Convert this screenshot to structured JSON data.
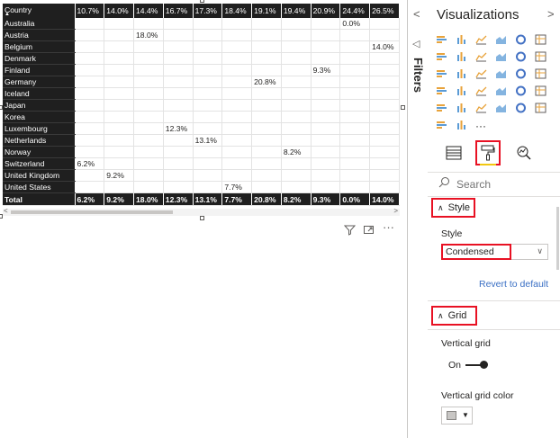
{
  "matrix": {
    "columns": [
      "Country",
      "10.7%",
      "14.0%",
      "14.4%",
      "16.7%",
      "17.3%",
      "18.4%",
      "19.1%",
      "19.4%",
      "20.9%",
      "24.4%",
      "26.5%"
    ],
    "rows": [
      {
        "label": "Australia",
        "cells": [
          "",
          "",
          "",
          "",
          "",
          "",
          "",
          "",
          "",
          "0.0%",
          ""
        ]
      },
      {
        "label": "Austria",
        "cells": [
          "",
          "",
          "18.0%",
          "",
          "",
          "",
          "",
          "",
          "",
          "",
          ""
        ]
      },
      {
        "label": "Belgium",
        "cells": [
          "",
          "",
          "",
          "",
          "",
          "",
          "",
          "",
          "",
          "",
          "14.0%"
        ]
      },
      {
        "label": "Denmark",
        "cells": [
          "",
          "",
          "",
          "",
          "",
          "",
          "",
          "",
          "",
          "",
          ""
        ]
      },
      {
        "label": "Finland",
        "cells": [
          "",
          "",
          "",
          "",
          "",
          "",
          "",
          "",
          "9.3%",
          "",
          ""
        ]
      },
      {
        "label": "Germany",
        "cells": [
          "",
          "",
          "",
          "",
          "",
          "",
          "20.8%",
          "",
          "",
          "",
          ""
        ]
      },
      {
        "label": "Iceland",
        "cells": [
          "",
          "",
          "",
          "",
          "",
          "",
          "",
          "",
          "",
          "",
          ""
        ]
      },
      {
        "label": "Japan",
        "cells": [
          "",
          "",
          "",
          "",
          "",
          "",
          "",
          "",
          "",
          "",
          ""
        ]
      },
      {
        "label": "Korea",
        "cells": [
          "",
          "",
          "",
          "",
          "",
          "",
          "",
          "",
          "",
          "",
          ""
        ]
      },
      {
        "label": "Luxembourg",
        "cells": [
          "",
          "",
          "",
          "12.3%",
          "",
          "",
          "",
          "",
          "",
          "",
          ""
        ]
      },
      {
        "label": "Netherlands",
        "cells": [
          "",
          "",
          "",
          "",
          "13.1%",
          "",
          "",
          "",
          "",
          "",
          ""
        ]
      },
      {
        "label": "Norway",
        "cells": [
          "",
          "",
          "",
          "",
          "",
          "",
          "",
          "8.2%",
          "",
          "",
          ""
        ]
      },
      {
        "label": "Switzerland",
        "cells": [
          "6.2%",
          "",
          "",
          "",
          "",
          "",
          "",
          "",
          "",
          "",
          ""
        ]
      },
      {
        "label": "United Kingdom",
        "cells": [
          "",
          "9.2%",
          "",
          "",
          "",
          "",
          "",
          "",
          "",
          "",
          ""
        ]
      },
      {
        "label": "United States",
        "cells": [
          "",
          "",
          "",
          "",
          "",
          "7.7%",
          "",
          "",
          "",
          "",
          ""
        ]
      }
    ],
    "total": {
      "label": "Total",
      "cells": [
        "6.2%",
        "9.2%",
        "18.0%",
        "12.3%",
        "13.1%",
        "7.7%",
        "20.8%",
        "8.2%",
        "9.3%",
        "0.0%",
        "14.0%"
      ]
    },
    "sort_indicator": "▲",
    "scroll_left": "<",
    "scroll_right": ">"
  },
  "visual_header": {
    "filter_icon": "filter-icon",
    "focus_icon": "focus-mode-icon",
    "more_label": "···"
  },
  "filters_pane": {
    "collapse_glyph": "<",
    "filter_glyph": "◁",
    "label": "Filters"
  },
  "visualizations": {
    "title": "Visualizations",
    "expand_glyph": ">",
    "more_label": "···",
    "tabs": [
      {
        "name": "fields-tab",
        "glyph": "▤"
      },
      {
        "name": "format-tab",
        "glyph": "⚲"
      },
      {
        "name": "analytics-tab",
        "glyph": "⌕"
      }
    ],
    "search_placeholder": "Search",
    "style_section": {
      "title": "Style",
      "property_label": "Style",
      "selected_value": "Condensed",
      "revert_label": "Revert to default"
    },
    "grid_section": {
      "title": "Grid",
      "vertical_grid_label": "Vertical grid",
      "toggle_state": "On",
      "vertical_grid_color_label": "Vertical grid color"
    }
  },
  "colors": {
    "header_bg": "#1f1f1f",
    "highlight_red": "#e81123",
    "accent_yellow": "#f2c811",
    "link_blue": "#3a6fc4"
  }
}
